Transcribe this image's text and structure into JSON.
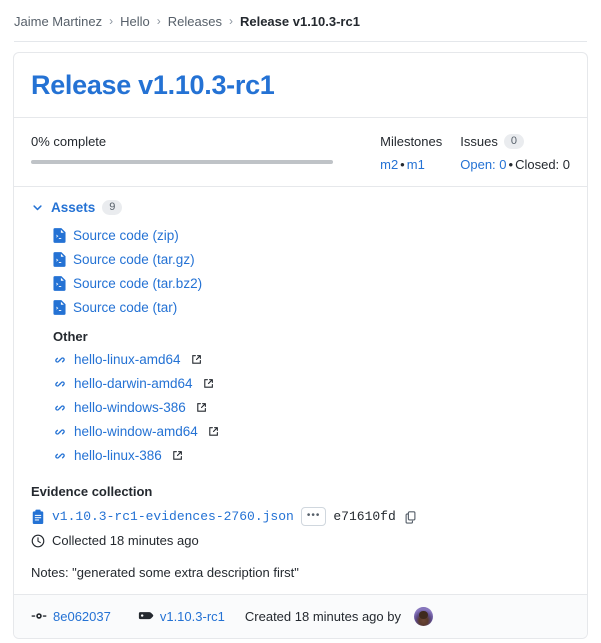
{
  "breadcrumb": {
    "items": [
      {
        "label": "Jaime Martinez",
        "current": false
      },
      {
        "label": "Hello",
        "current": false
      },
      {
        "label": "Releases",
        "current": false
      },
      {
        "label": "Release v1.10.3-rc1",
        "current": true
      }
    ],
    "separator": "›"
  },
  "release": {
    "title": "Release v1.10.3-rc1"
  },
  "progress": {
    "label": "0% complete",
    "percent": 0
  },
  "milestones": {
    "heading": "Milestones",
    "items": [
      "m2",
      "m1"
    ],
    "separator": "•",
    "item_0": "m2",
    "item_1": "m1"
  },
  "issues": {
    "heading": "Issues",
    "count": "0",
    "open_label": "Open: 0",
    "separator": "•",
    "closed_label": "Closed: 0"
  },
  "assets": {
    "label": "Assets",
    "count": "9",
    "chevron": "chevron-down-icon",
    "source_files": [
      {
        "name": "Source code (zip)",
        "icon": "file-code-icon"
      },
      {
        "name": "Source code (tar.gz)",
        "icon": "file-code-icon"
      },
      {
        "name": "Source code (tar.bz2)",
        "icon": "file-code-icon"
      },
      {
        "name": "Source code (tar)",
        "icon": "file-code-icon"
      }
    ],
    "other_heading": "Other",
    "other_files": [
      {
        "name": "hello-linux-amd64",
        "icon": "link-icon"
      },
      {
        "name": "hello-darwin-amd64",
        "icon": "link-icon"
      },
      {
        "name": "hello-windows-386",
        "icon": "link-icon"
      },
      {
        "name": "hello-window-amd64",
        "icon": "link-icon"
      },
      {
        "name": "hello-linux-386",
        "icon": "link-icon"
      }
    ]
  },
  "evidence": {
    "heading": "Evidence collection",
    "file_name": "v1.10.3-rc1-evidences-2760.json",
    "more_label": "•••",
    "hash": "e71610fd",
    "collected_text": "Collected 18 minutes ago"
  },
  "notes": {
    "text": "Notes: \"generated some extra description first\""
  },
  "footer": {
    "commit_sha": "8e062037",
    "tag_name": "v1.10.3-rc1",
    "created_text": "Created 18 minutes ago by"
  },
  "colors": {
    "link": "#2472d4",
    "text": "#24292f",
    "muted": "#57606a",
    "border": "#e6e8eb",
    "badge_bg": "#eaecef",
    "footer_bg": "#fafbfc",
    "progress_track": "#bfc3c7"
  }
}
